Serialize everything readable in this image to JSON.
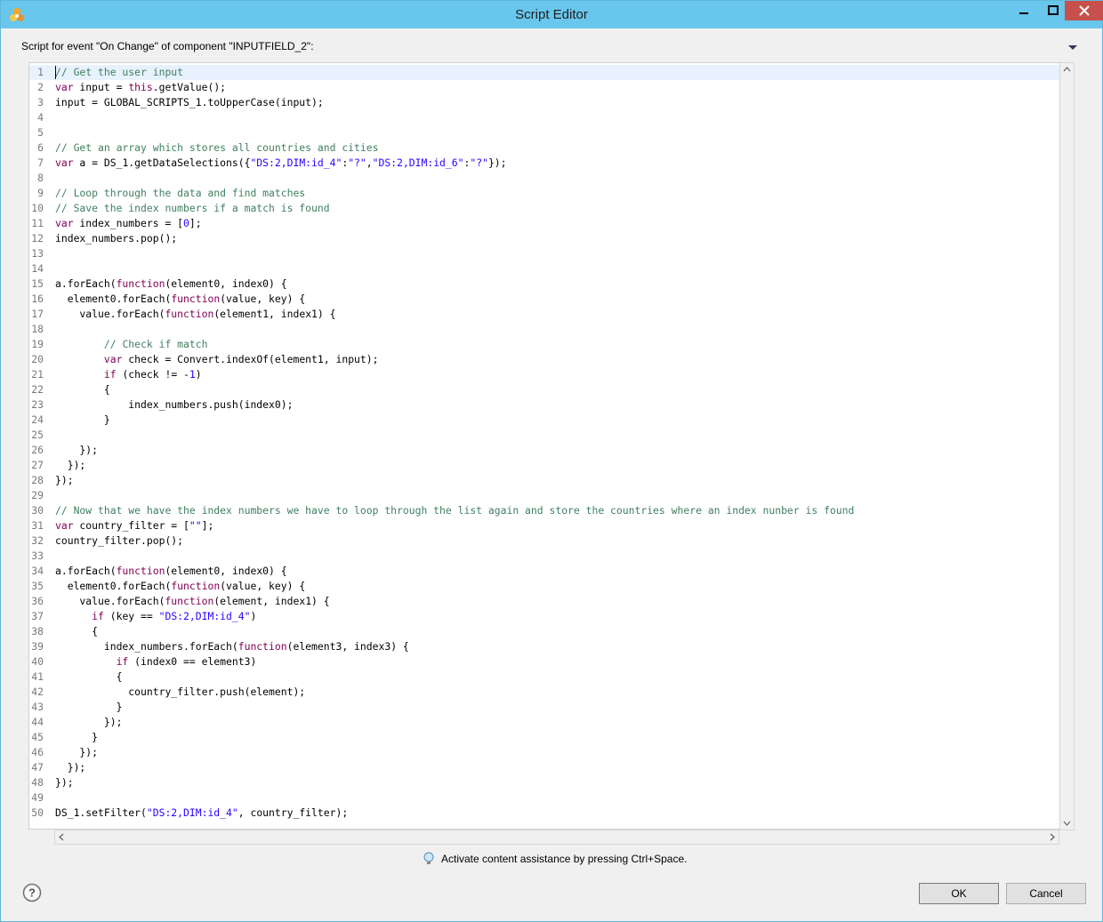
{
  "window": {
    "title": "Script Editor"
  },
  "header": {
    "event_label": "Script for event \"On Change\" of component \"INPUTFIELD_2\":"
  },
  "editor": {
    "lines": [
      [
        {
          "t": "c",
          "v": "// Get the user input"
        }
      ],
      [
        {
          "t": "k",
          "v": "var"
        },
        {
          "t": "p",
          "v": " input = "
        },
        {
          "t": "k",
          "v": "this"
        },
        {
          "t": "p",
          "v": ".getValue();"
        }
      ],
      [
        {
          "t": "p",
          "v": "input = GLOBAL_SCRIPTS_1.toUpperCase(input);"
        }
      ],
      [],
      [],
      [
        {
          "t": "c",
          "v": "// Get an array which stores all countries and cities"
        }
      ],
      [
        {
          "t": "k",
          "v": "var"
        },
        {
          "t": "p",
          "v": " a = DS_1.getDataSelections({"
        },
        {
          "t": "s",
          "v": "\"DS:2,DIM:id_4\""
        },
        {
          "t": "p",
          "v": ":"
        },
        {
          "t": "s",
          "v": "\"?\""
        },
        {
          "t": "p",
          "v": ","
        },
        {
          "t": "s",
          "v": "\"DS:2,DIM:id_6\""
        },
        {
          "t": "p",
          "v": ":"
        },
        {
          "t": "s",
          "v": "\"?\""
        },
        {
          "t": "p",
          "v": "});"
        }
      ],
      [],
      [
        {
          "t": "c",
          "v": "// Loop through the data and find matches"
        }
      ],
      [
        {
          "t": "c",
          "v": "// Save the index numbers if a match is found"
        }
      ],
      [
        {
          "t": "k",
          "v": "var"
        },
        {
          "t": "p",
          "v": " index_numbers = ["
        },
        {
          "t": "s",
          "v": "0"
        },
        {
          "t": "p",
          "v": "];"
        }
      ],
      [
        {
          "t": "p",
          "v": "index_numbers.pop();"
        }
      ],
      [],
      [],
      [
        {
          "t": "p",
          "v": "a.forEach("
        },
        {
          "t": "k",
          "v": "function"
        },
        {
          "t": "p",
          "v": "(element0, index0) {"
        }
      ],
      [
        {
          "t": "p",
          "v": "  element0.forEach("
        },
        {
          "t": "k",
          "v": "function"
        },
        {
          "t": "p",
          "v": "(value, key) {"
        }
      ],
      [
        {
          "t": "p",
          "v": "    value.forEach("
        },
        {
          "t": "k",
          "v": "function"
        },
        {
          "t": "p",
          "v": "(element1, index1) {"
        }
      ],
      [],
      [
        {
          "t": "p",
          "v": "        "
        },
        {
          "t": "c",
          "v": "// Check if match"
        }
      ],
      [
        {
          "t": "p",
          "v": "        "
        },
        {
          "t": "k",
          "v": "var"
        },
        {
          "t": "p",
          "v": " check = Convert.indexOf(element1, input);"
        }
      ],
      [
        {
          "t": "p",
          "v": "        "
        },
        {
          "t": "k",
          "v": "if"
        },
        {
          "t": "p",
          "v": " (check != -"
        },
        {
          "t": "s",
          "v": "1"
        },
        {
          "t": "p",
          "v": ")"
        }
      ],
      [
        {
          "t": "p",
          "v": "        {"
        }
      ],
      [
        {
          "t": "p",
          "v": "            index_numbers.push(index0);"
        }
      ],
      [
        {
          "t": "p",
          "v": "        }"
        }
      ],
      [],
      [
        {
          "t": "p",
          "v": "    });"
        }
      ],
      [
        {
          "t": "p",
          "v": "  });"
        }
      ],
      [
        {
          "t": "p",
          "v": "});"
        }
      ],
      [],
      [
        {
          "t": "c",
          "v": "// Now that we have the index numbers we have to loop through the list again and store the countries where an index nunber is found"
        }
      ],
      [
        {
          "t": "k",
          "v": "var"
        },
        {
          "t": "p",
          "v": " country_filter = ["
        },
        {
          "t": "s",
          "v": "\"\""
        },
        {
          "t": "p",
          "v": "];"
        }
      ],
      [
        {
          "t": "p",
          "v": "country_filter.pop();"
        }
      ],
      [],
      [
        {
          "t": "p",
          "v": "a.forEach("
        },
        {
          "t": "k",
          "v": "function"
        },
        {
          "t": "p",
          "v": "(element0, index0) {"
        }
      ],
      [
        {
          "t": "p",
          "v": "  element0.forEach("
        },
        {
          "t": "k",
          "v": "function"
        },
        {
          "t": "p",
          "v": "(value, key) {"
        }
      ],
      [
        {
          "t": "p",
          "v": "    value.forEach("
        },
        {
          "t": "k",
          "v": "function"
        },
        {
          "t": "p",
          "v": "(element, index1) {"
        }
      ],
      [
        {
          "t": "p",
          "v": "      "
        },
        {
          "t": "k",
          "v": "if"
        },
        {
          "t": "p",
          "v": " (key == "
        },
        {
          "t": "s",
          "v": "\"DS:2,DIM:id_4\""
        },
        {
          "t": "p",
          "v": ")"
        }
      ],
      [
        {
          "t": "p",
          "v": "      {"
        }
      ],
      [
        {
          "t": "p",
          "v": "        index_numbers.forEach("
        },
        {
          "t": "k",
          "v": "function"
        },
        {
          "t": "p",
          "v": "(element3, index3) {"
        }
      ],
      [
        {
          "t": "p",
          "v": "          "
        },
        {
          "t": "k",
          "v": "if"
        },
        {
          "t": "p",
          "v": " (index0 == element3)"
        }
      ],
      [
        {
          "t": "p",
          "v": "          {"
        }
      ],
      [
        {
          "t": "p",
          "v": "            country_filter.push(element);"
        }
      ],
      [
        {
          "t": "p",
          "v": "          }"
        }
      ],
      [
        {
          "t": "p",
          "v": "        });"
        }
      ],
      [
        {
          "t": "p",
          "v": "      }"
        }
      ],
      [
        {
          "t": "p",
          "v": "    });"
        }
      ],
      [
        {
          "t": "p",
          "v": "  });"
        }
      ],
      [
        {
          "t": "p",
          "v": "});"
        }
      ],
      [],
      [
        {
          "t": "p",
          "v": "DS_1.setFilter("
        },
        {
          "t": "s",
          "v": "\"DS:2,DIM:id_4\""
        },
        {
          "t": "p",
          "v": ", country_filter);"
        }
      ]
    ]
  },
  "footer": {
    "assist_text": "Activate content assistance by pressing Ctrl+Space.",
    "ok_label": "OK",
    "cancel_label": "Cancel"
  },
  "colors": {
    "titlebar": "#69c6ec",
    "close_button": "#c7504c",
    "comment": "#3f7f5f",
    "keyword": "#7f0055",
    "string": "#2a00ff"
  }
}
